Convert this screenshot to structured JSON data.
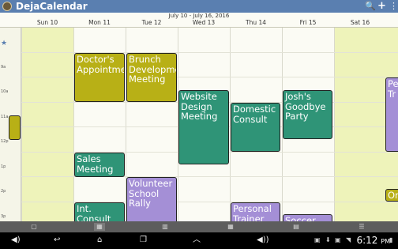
{
  "app": {
    "title": "DejaCalendar",
    "actions": {
      "search": "🔍",
      "add": "+",
      "menu": "⋮"
    }
  },
  "calendar": {
    "range": "July 10 - July 16, 2016",
    "days": [
      "Sun 10",
      "Mon 11",
      "Tue 12",
      "Wed 13",
      "Thu 14",
      "Fri 15",
      "Sat 16"
    ],
    "times": [
      "9a",
      "10a",
      "11a",
      "12p",
      "1p",
      "2p",
      "3p"
    ],
    "events": [
      {
        "name": "doctor",
        "text": "Doctor's Appointment",
        "color": "#b8b016"
      },
      {
        "name": "brunch",
        "text": "Brunch Development Meeting",
        "color": "#b8b016"
      },
      {
        "name": "website",
        "text": "Website Design Meeting",
        "color": "#2f9477"
      },
      {
        "name": "domestic",
        "text": "Domestic Consult",
        "color": "#2f9477"
      },
      {
        "name": "josh",
        "text": "Josh's Goodbye Party",
        "color": "#2f9477"
      },
      {
        "name": "sales",
        "text": "Sales Meeting",
        "color": "#2f9477"
      },
      {
        "name": "volunteer",
        "text": "Volunteer School Rally",
        "color": "#a48fd6"
      },
      {
        "name": "intconsult",
        "text": "Int. Consult",
        "color": "#2f9477"
      },
      {
        "name": "trainer",
        "text": "Personal Trainer",
        "color": "#a48fd6"
      },
      {
        "name": "soccer",
        "text": "Soccer",
        "color": "#a48fd6"
      },
      {
        "name": "sat-pe",
        "text": "Pe Tr",
        "color": "#a48fd6"
      },
      {
        "name": "sat-or",
        "text": "Or",
        "color": "#b8b016"
      }
    ]
  },
  "status": {
    "time": "6:12",
    "ampm": "PM"
  }
}
